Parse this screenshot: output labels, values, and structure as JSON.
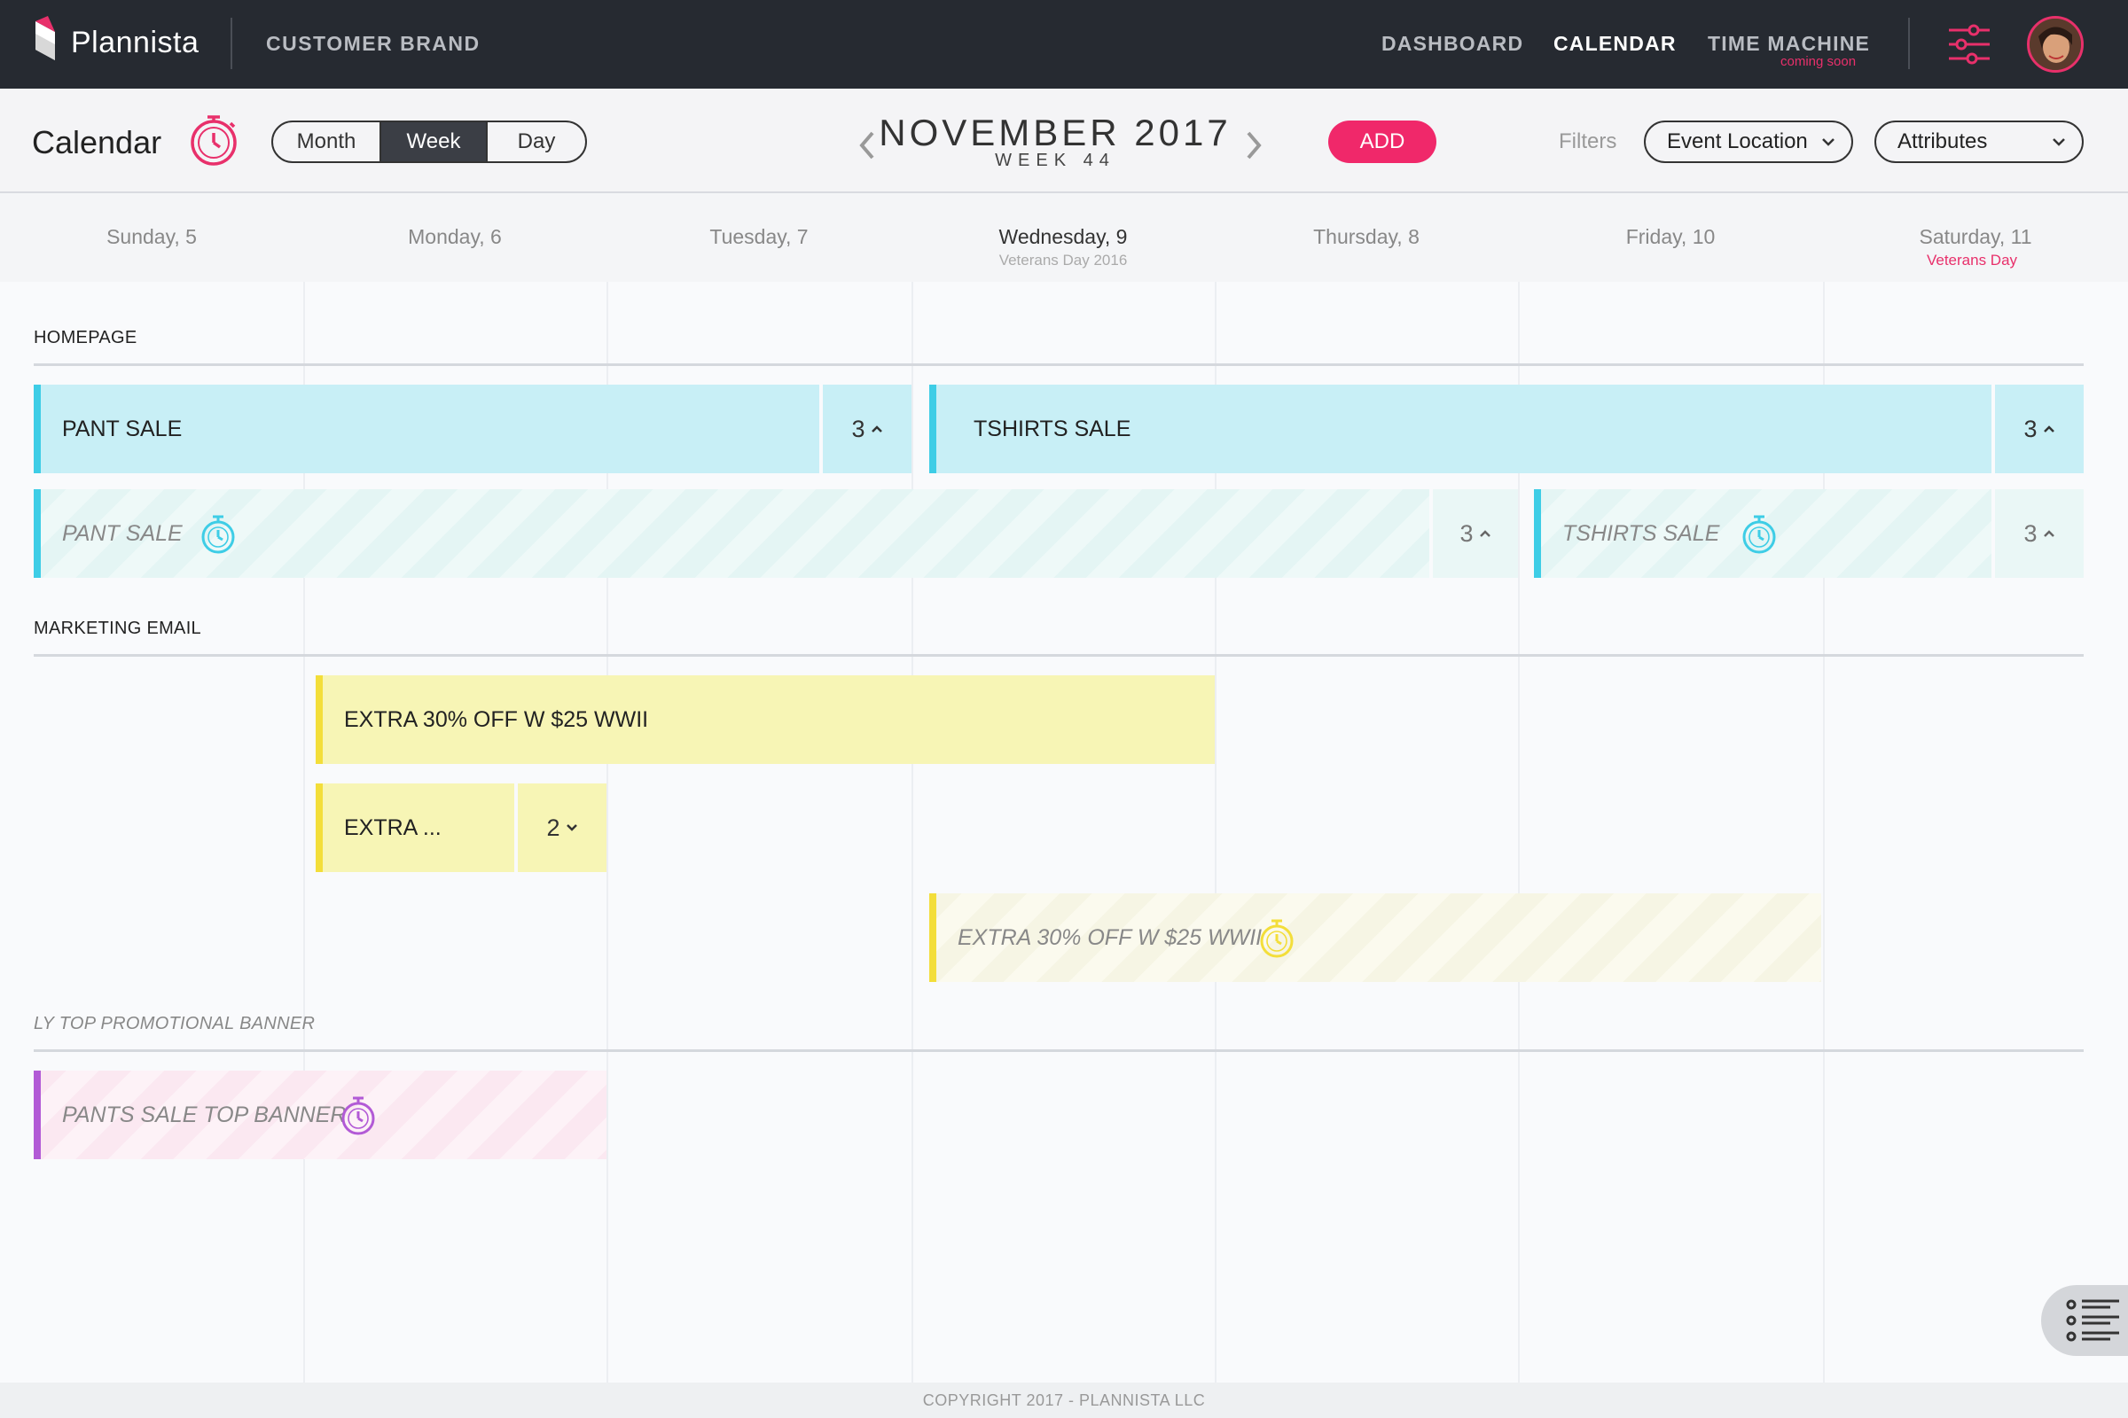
{
  "topbar": {
    "logo_text": "Plannista",
    "brand": "CUSTOMER BRAND",
    "nav": [
      {
        "label": "DASHBOARD"
      },
      {
        "label": "CALENDAR"
      },
      {
        "label": "TIME MACHINE",
        "sub": "coming soon"
      }
    ],
    "accent": "#e8306b"
  },
  "toolbar": {
    "title": "Calendar",
    "views": [
      "Month",
      "Week",
      "Day"
    ],
    "active_view": "Week",
    "month": "NOVEMBER 2017",
    "week": "WEEK 44",
    "add_label": "ADD",
    "filters_label": "Filters",
    "filter_location": "Event Location",
    "filter_attributes": "Attributes"
  },
  "days": [
    {
      "label": "Sunday, 5",
      "sub": ""
    },
    {
      "label": "Monday, 6",
      "sub": ""
    },
    {
      "label": "Tuesday, 7",
      "sub": ""
    },
    {
      "label": "Wednesday, 9",
      "sub": "Veterans Day 2016"
    },
    {
      "label": "Thursday, 8",
      "sub": ""
    },
    {
      "label": "Friday, 10",
      "sub": ""
    },
    {
      "label": "Saturday, 11",
      "sub": "Veterans Day"
    }
  ],
  "sections": {
    "homepage": "HOMEPAGE",
    "marketing": "MARKETING EMAIL",
    "banner": "LY TOP PROMOTIONAL BANNER"
  },
  "events": {
    "pant_sale": {
      "title": "PANT SALE",
      "count": "3"
    },
    "tshirts_sale": {
      "title": "TSHIRTS SALE",
      "count": "3"
    },
    "pant_sale_ghost": {
      "title": "PANT SALE",
      "count": "3"
    },
    "tshirts_sale_ghost": {
      "title": "TSHIRTS SALE",
      "count": "3"
    },
    "extra_30": {
      "title": "EXTRA 30% OFF W $25 WWII"
    },
    "extra_short": {
      "title": "EXTRA ...",
      "count": "2"
    },
    "extra_30_ghost": {
      "title": "EXTRA 30% OFF W $25 WWII"
    },
    "pants_banner_ghost": {
      "title": "PANTS SALE TOP BANNER"
    }
  },
  "footer": {
    "copyright": "COPYRIGHT 2017 - PLANNISTA LLC"
  },
  "colors": {
    "blue_bar": "#3ecde6",
    "yellow_bar": "#f3de3a",
    "purple_bar": "#b25ad6",
    "add_button": "#f0286a"
  }
}
